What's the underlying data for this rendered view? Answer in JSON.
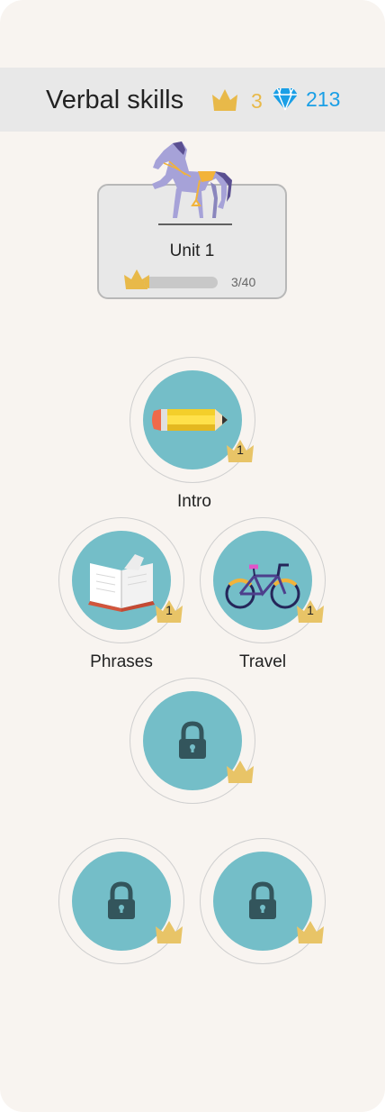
{
  "header": {
    "title": "Verbal skills",
    "crowns": "3",
    "gems": "213",
    "crown_color": "#e8b949",
    "gem_color": "#1a9fe6"
  },
  "unit": {
    "title": "Unit 1",
    "progress_text": "3/40",
    "progress_fraction": 0.075,
    "icon": "horse-illustration"
  },
  "skills": [
    {
      "label": "Intro",
      "level": "1",
      "icon": "pencil-icon",
      "locked": false
    },
    {
      "label": "Phrases",
      "level": "1",
      "icon": "book-icon",
      "locked": false
    },
    {
      "label": "Travel",
      "level": "1",
      "icon": "bicycle-icon",
      "locked": false
    },
    {
      "label": "",
      "level": "",
      "icon": "lock-icon",
      "locked": true
    },
    {
      "label": "",
      "level": "",
      "icon": "lock-icon",
      "locked": true
    },
    {
      "label": "",
      "level": "",
      "icon": "lock-icon",
      "locked": true
    }
  ],
  "colors": {
    "background": "#f8f4f0",
    "skill_disc": "#74bec8",
    "lock": "#33555c"
  }
}
